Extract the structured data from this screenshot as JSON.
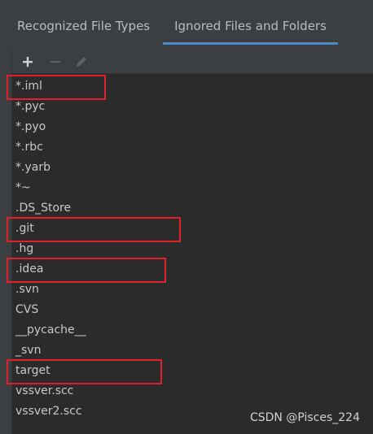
{
  "tabs": [
    {
      "label": "Recognized File Types"
    },
    {
      "label": "Ignored Files and Folders",
      "active": true
    }
  ],
  "toolbar": {
    "add_icon": "plus-icon",
    "remove_icon": "minus-icon",
    "edit_icon": "pencil-icon"
  },
  "ignored": [
    "*.iml",
    "*.pyc",
    "*.pyo",
    "*.rbc",
    "*.yarb",
    "*~",
    ".DS_Store",
    ".git",
    ".hg",
    ".idea",
    ".svn",
    "CVS",
    "__pycache__",
    "_svn",
    "target",
    "vssver.scc",
    "vssver2.scc"
  ],
  "highlighted": [
    "*.iml",
    ".git",
    ".idea",
    "target"
  ],
  "watermark": "CSDN @Pisces_224",
  "colors": {
    "accent": "#4a88c7",
    "highlight_box": "#e0212a",
    "list_background": "#2b2b2b",
    "chrome_background": "#3c3f41"
  }
}
